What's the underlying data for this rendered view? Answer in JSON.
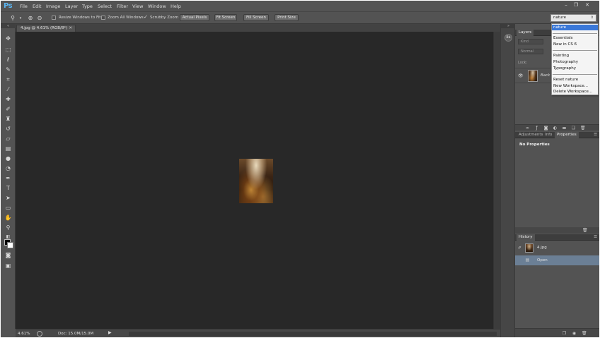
{
  "app": {
    "logo": "Ps"
  },
  "menu": [
    "File",
    "Edit",
    "Image",
    "Layer",
    "Type",
    "Select",
    "Filter",
    "View",
    "Window",
    "Help"
  ],
  "window_controls": {
    "minimize": "–",
    "maximize": "❐",
    "close": "✕"
  },
  "options": {
    "resize_label": "Resize Windows to Fit",
    "zoom_all_label": "Zoom All Windows",
    "scrubby_label": "Scrubby Zoom",
    "actual_pixels": "Actual Pixels",
    "fit_screen": "Fit Screen",
    "fill_screen": "Fill Screen",
    "print_size": "Print Size",
    "workspace": "nature"
  },
  "document": {
    "tab_title": "4.jpg @ 4.61% (RGB/8*)",
    "zoom": "4.61%",
    "doc_size": "Doc: 15.0M/15.0M"
  },
  "panels": {
    "layers": {
      "tab": "Layers",
      "kind_placeholder": "Kind",
      "blend_mode": "Normal",
      "lock_label": "Lock:",
      "layer_name": "Back"
    },
    "properties": {
      "tabs": [
        "Adjustments",
        "Info",
        "Properties"
      ],
      "active_tab": "Properties",
      "empty_message": "No Properties"
    },
    "history": {
      "tab": "History",
      "snapshot": "4.jpg",
      "states": [
        "Open"
      ]
    }
  },
  "workspace_menu": {
    "selected": "nature",
    "group1": [
      "Essentials",
      "New in CS 6"
    ],
    "group2": [
      "Painting",
      "Photography",
      "Typography"
    ],
    "group3": [
      "Reset nature",
      "New Workspace...",
      "Delete Workspace..."
    ]
  },
  "icons": {
    "tools": [
      "move-icon",
      "marquee-icon",
      "lasso-icon",
      "quick-select-icon",
      "crop-icon",
      "eyedropper-icon",
      "healing-brush-icon",
      "brush-icon",
      "clone-stamp-icon",
      "history-brush-icon",
      "eraser-icon",
      "gradient-icon",
      "blur-icon",
      "dodge-icon",
      "pen-icon",
      "type-icon",
      "path-select-icon",
      "shape-icon",
      "hand-icon",
      "zoom-icon"
    ]
  },
  "colors": {
    "chrome": "#535353",
    "canvas": "#282828",
    "selection": "#3a78d8",
    "history_selected": "#6b7f95"
  }
}
